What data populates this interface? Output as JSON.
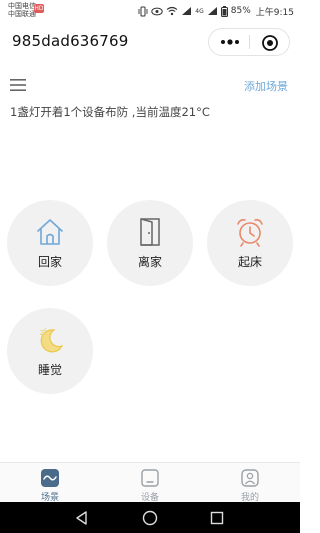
{
  "status_bar": {
    "carrier_1": "中国电信",
    "carrier_2": "中国联通",
    "sim_badge": "HD",
    "signal_tag": "4G",
    "battery": "85%",
    "time": "上午9:15"
  },
  "app": {
    "title": "985dad636769"
  },
  "toolbar": {
    "add_scene_label": "添加场景"
  },
  "status_text": "1盏灯开着1个设备布防 ,当前温度21°C",
  "scenes": [
    {
      "label": "回家",
      "icon": "home-icon",
      "color": "#6fa8d8"
    },
    {
      "label": "离家",
      "icon": "door-icon",
      "color": "#666666"
    },
    {
      "label": "起床",
      "icon": "alarm-clock-icon",
      "color": "#e8896b"
    },
    {
      "label": "睡觉",
      "icon": "moon-icon",
      "color": "#e9c84a"
    }
  ],
  "tabs": [
    {
      "label": "场景",
      "active": true
    },
    {
      "label": "设备",
      "active": false
    },
    {
      "label": "我的",
      "active": false
    }
  ],
  "colors": {
    "accent": "#6fa8d8",
    "tile_bg": "#f1f1f1",
    "tab_active": "#4a6b8a",
    "tab_inactive": "#9aa0a6"
  }
}
